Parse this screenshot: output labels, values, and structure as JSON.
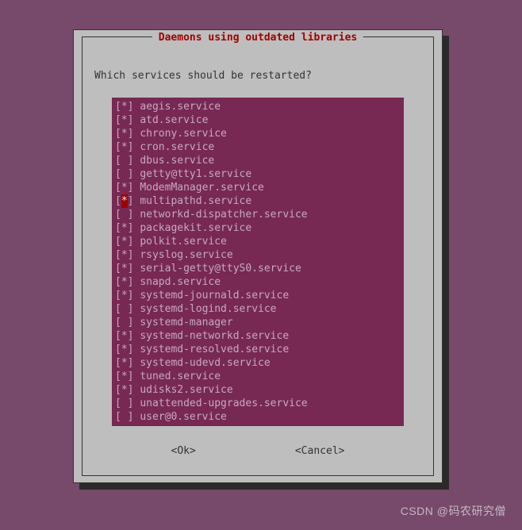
{
  "dialog": {
    "title": "Daemons using outdated libraries",
    "question": "Which services should be restarted?",
    "buttons": {
      "ok": "<Ok>",
      "cancel": "<Cancel>"
    }
  },
  "services": [
    {
      "checked": true,
      "highlighted": false,
      "name": "aegis.service"
    },
    {
      "checked": true,
      "highlighted": false,
      "name": "atd.service"
    },
    {
      "checked": true,
      "highlighted": false,
      "name": "chrony.service"
    },
    {
      "checked": true,
      "highlighted": false,
      "name": "cron.service"
    },
    {
      "checked": false,
      "highlighted": false,
      "name": "dbus.service"
    },
    {
      "checked": false,
      "highlighted": false,
      "name": "getty@tty1.service"
    },
    {
      "checked": true,
      "highlighted": false,
      "name": "ModemManager.service"
    },
    {
      "checked": true,
      "highlighted": true,
      "name": "multipathd.service"
    },
    {
      "checked": false,
      "highlighted": false,
      "name": "networkd-dispatcher.service"
    },
    {
      "checked": true,
      "highlighted": false,
      "name": "packagekit.service"
    },
    {
      "checked": true,
      "highlighted": false,
      "name": "polkit.service"
    },
    {
      "checked": true,
      "highlighted": false,
      "name": "rsyslog.service"
    },
    {
      "checked": true,
      "highlighted": false,
      "name": "serial-getty@ttyS0.service"
    },
    {
      "checked": true,
      "highlighted": false,
      "name": "snapd.service"
    },
    {
      "checked": true,
      "highlighted": false,
      "name": "systemd-journald.service"
    },
    {
      "checked": false,
      "highlighted": false,
      "name": "systemd-logind.service"
    },
    {
      "checked": false,
      "highlighted": false,
      "name": "systemd-manager"
    },
    {
      "checked": true,
      "highlighted": false,
      "name": "systemd-networkd.service"
    },
    {
      "checked": true,
      "highlighted": false,
      "name": "systemd-resolved.service"
    },
    {
      "checked": true,
      "highlighted": false,
      "name": "systemd-udevd.service"
    },
    {
      "checked": true,
      "highlighted": false,
      "name": "tuned.service"
    },
    {
      "checked": true,
      "highlighted": false,
      "name": "udisks2.service"
    },
    {
      "checked": false,
      "highlighted": false,
      "name": "unattended-upgrades.service"
    },
    {
      "checked": false,
      "highlighted": false,
      "name": "user@0.service"
    }
  ],
  "watermark": "CSDN @码农研究僧"
}
